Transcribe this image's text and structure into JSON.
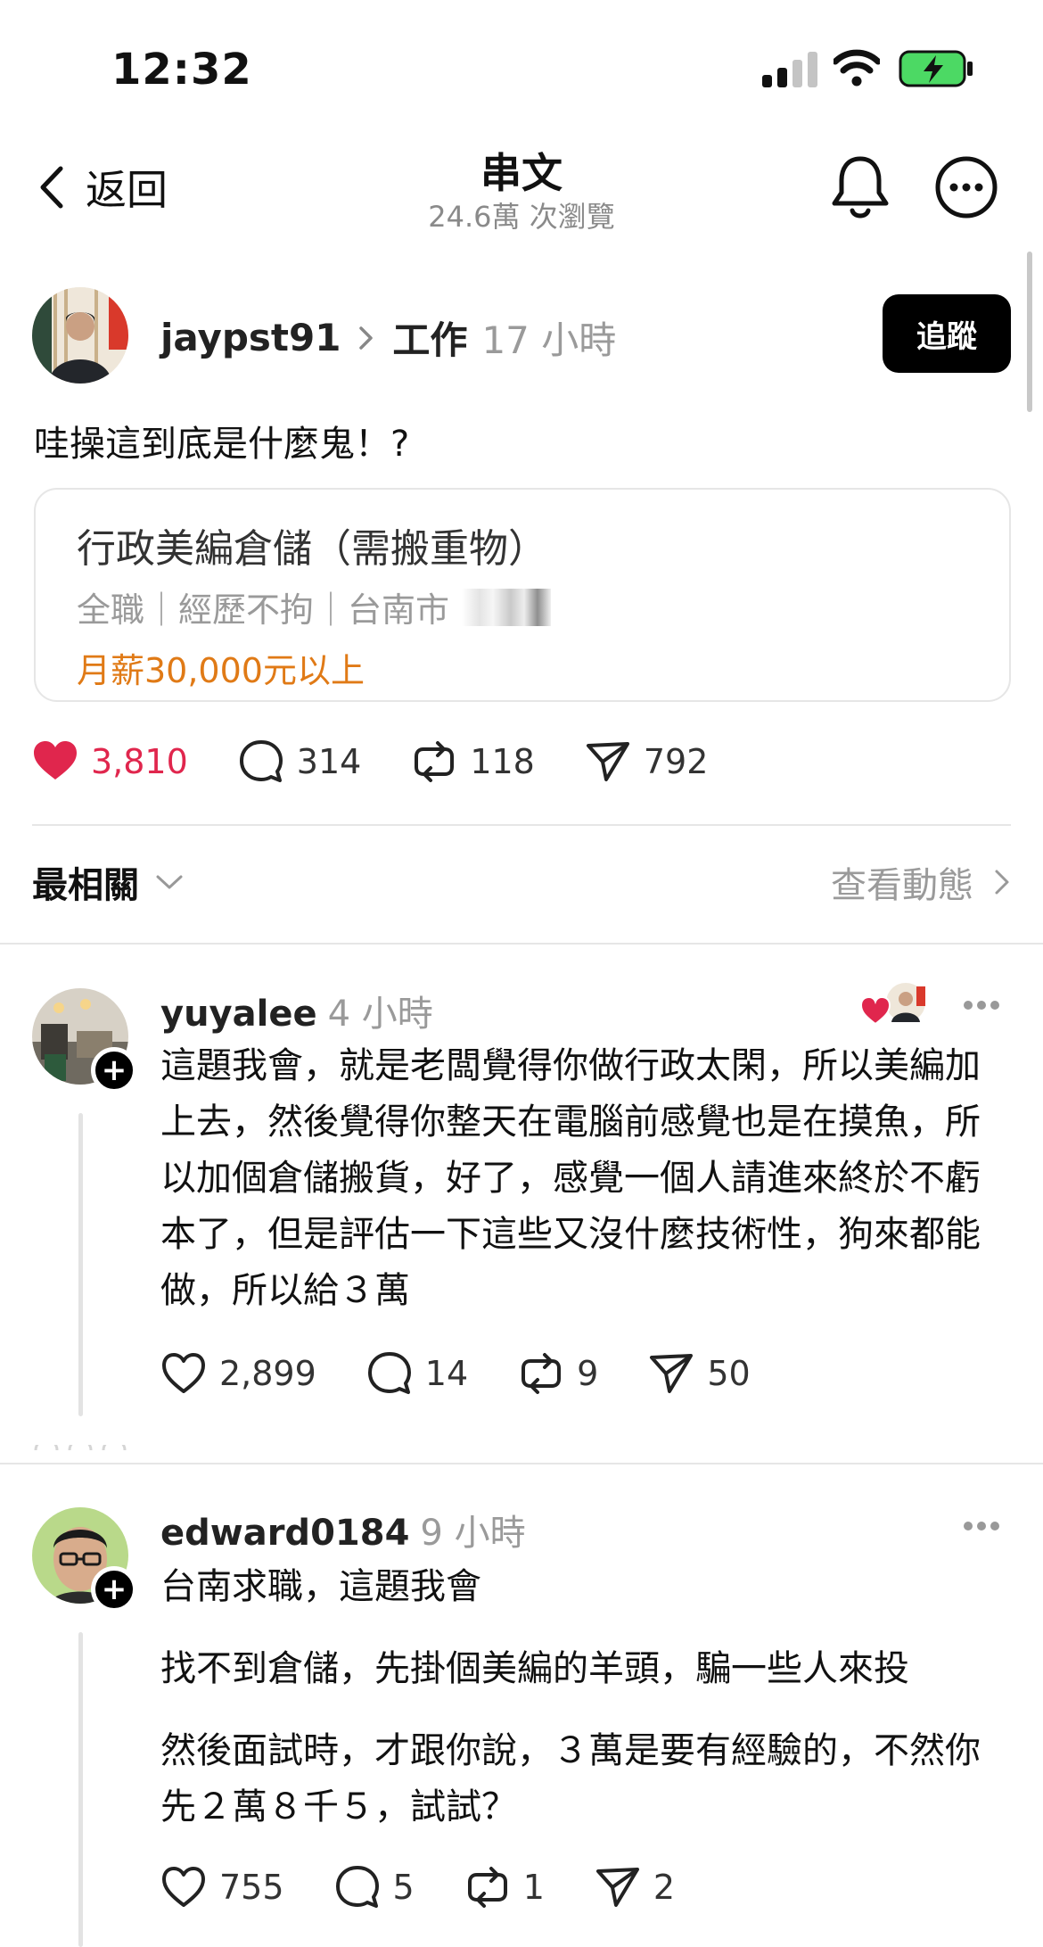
{
  "status_bar": {
    "time": "12:32"
  },
  "nav": {
    "back_label": "返回",
    "title": "串文",
    "subtitle": "24.6萬 次瀏覽"
  },
  "post": {
    "username": "jaypst91",
    "topic": "工作",
    "time": "17 小時",
    "follow_label": "追蹤",
    "text": "哇操這到底是什麼鬼！?",
    "job_card": {
      "title": "行政美編倉儲（需搬重物）",
      "meta": "全職｜經歷不拘｜台南市",
      "salary": "月薪30,000元以上"
    },
    "actions": {
      "likes": "3,810",
      "comments": "314",
      "reposts": "118",
      "shares": "792"
    }
  },
  "sort": {
    "label": "最相關",
    "activity_label": "查看動態"
  },
  "comments": [
    {
      "username": "yuyalee",
      "time": "4 小時",
      "text": "這題我會，就是老闆覺得你做行政太閑，所以美編加上去，然後覺得你整天在電腦前感覺也是在摸魚，所以加個倉儲搬貨，好了，感覺一個人請進來終於不虧本了，但是評估一下這些又沒什麼技術性，狗來都能做，所以給３萬",
      "likes": "2,899",
      "replies": "14",
      "reposts": "9",
      "shares": "50"
    },
    {
      "username": "edward0184",
      "time": "9 小時",
      "paragraphs": [
        "台南求職，這題我會",
        "找不到倉儲，先掛個美編的羊頭，騙一些人來投",
        "然後面試時，才跟你說，３萬是要有經驗的，不然你先２萬８千５，試試？"
      ],
      "likes": "755",
      "replies": "5",
      "reposts": "1",
      "shares": "2"
    }
  ],
  "colors": {
    "like_red": "#e0264d",
    "salary_orange": "#e07a16",
    "muted_gray": "#9a9a9a",
    "battery_green": "#4cd964"
  }
}
